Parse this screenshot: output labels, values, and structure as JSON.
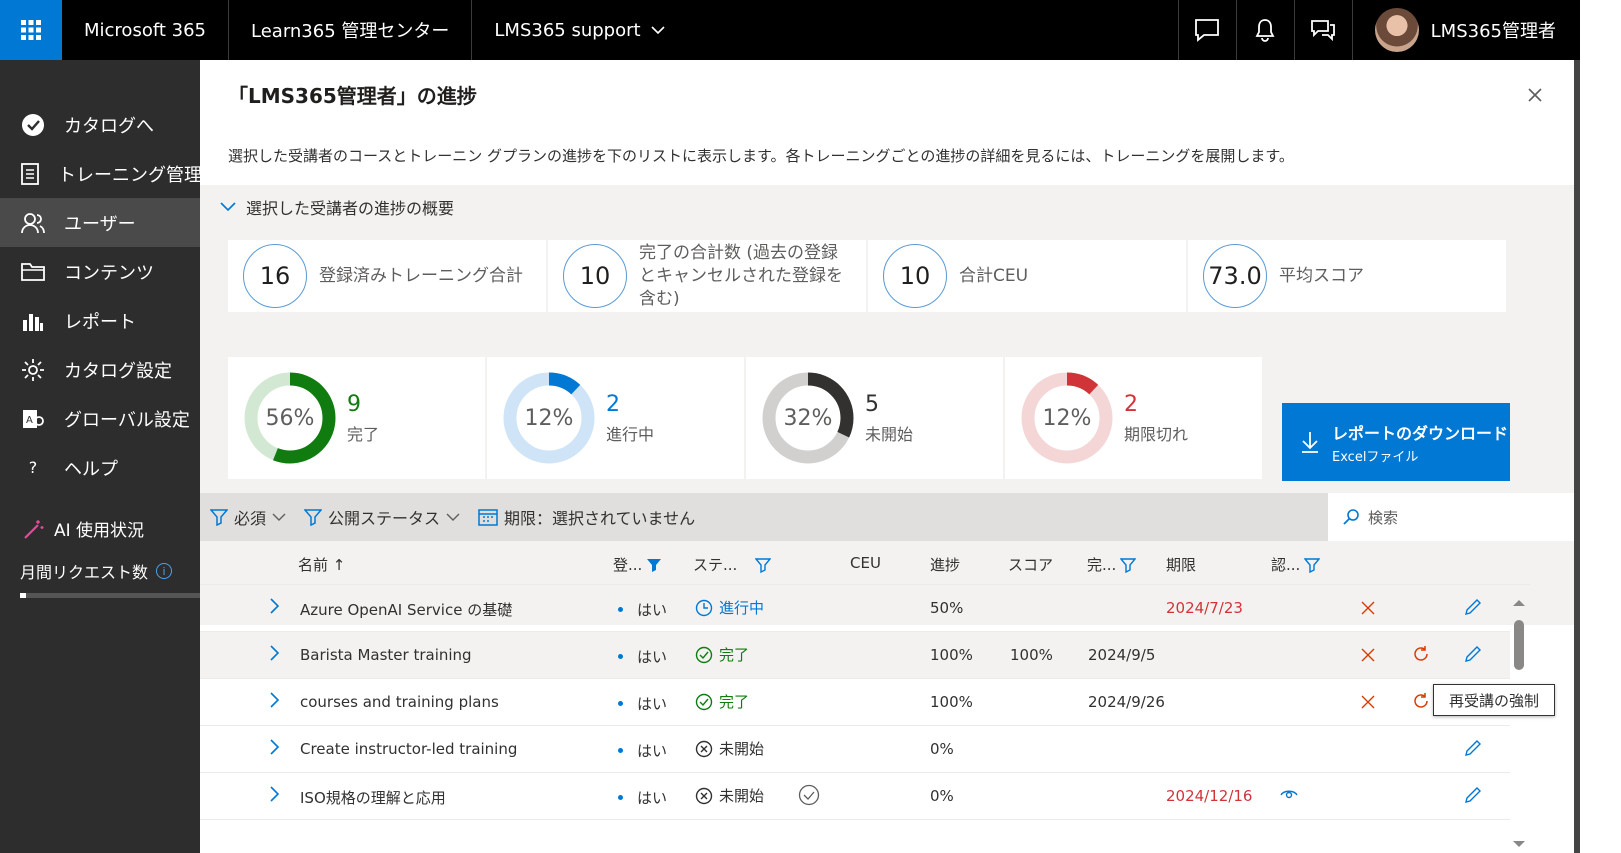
{
  "topbar": {
    "app": "Microsoft 365",
    "center": "Learn365 管理センター",
    "tenant": "LMS365 support",
    "user": "LMS365管理者"
  },
  "sidebar": {
    "items": [
      {
        "label": "カタログへ",
        "icon": "check-circle-icon"
      },
      {
        "label": "トレーニング管理",
        "icon": "document-icon"
      },
      {
        "label": "ユーザー",
        "icon": "users-icon",
        "active": true
      },
      {
        "label": "コンテンツ",
        "icon": "folder-icon"
      },
      {
        "label": "レポート",
        "icon": "chart-icon"
      },
      {
        "label": "カタログ設定",
        "icon": "gear-icon"
      },
      {
        "label": "グローバル設定",
        "icon": "global-settings-icon"
      },
      {
        "label": "ヘルプ",
        "icon": "question-icon"
      }
    ],
    "ai_usage": "AI 使用状況",
    "monthly_requests": "月間リクエスト数"
  },
  "panel": {
    "title": "「LMS365管理者」の進捗",
    "description": "選択した受講者のコースとトレーニン グプランの進捗を下のリストに表示します。各トレーニングごとの進捗の詳細を見るには、トレーニングを展開します。",
    "summary_heading": "選択した受講者の進捗の概要"
  },
  "kpis": [
    {
      "value": "16",
      "label": "登録済みトレーニング合計"
    },
    {
      "value": "10",
      "label": "完了の合計数 (過去の登録とキャンセルされた登録を含む)"
    },
    {
      "value": "10",
      "label": "合計CEU"
    },
    {
      "value": "73.0",
      "label": "平均スコア"
    }
  ],
  "donuts": [
    {
      "pct": "56%",
      "fraction": 0.56,
      "count": "9",
      "label": "完了",
      "color": "#107c10",
      "track": "#d3e8d3",
      "count_color": "#107c10"
    },
    {
      "pct": "12%",
      "fraction": 0.12,
      "count": "2",
      "label": "進行中",
      "color": "#0078d4",
      "track": "#cfe4f6",
      "count_color": "#0078d4"
    },
    {
      "pct": "32%",
      "fraction": 0.32,
      "count": "5",
      "label": "未開始",
      "color": "#323130",
      "track": "#d2d0ce",
      "count_color": "#323130"
    },
    {
      "pct": "12%",
      "fraction": 0.12,
      "count": "2",
      "label": "期限切れ",
      "color": "#d13438",
      "track": "#f4d6d7",
      "count_color": "#d13438"
    }
  ],
  "download": {
    "label": "レポートのダウンロード",
    "sub": "Excelファイル"
  },
  "filters": {
    "required": "必須",
    "publish": "公開ステータス",
    "deadline": "期限：選択されていません",
    "search_placeholder": "検索"
  },
  "columns": {
    "name": "名前 ↑",
    "reg": "登...",
    "status": "ステ...",
    "ceu": "CEU",
    "progress": "進捗",
    "score": "スコア",
    "completed": "完...",
    "deadline": "期限",
    "cert": "認..."
  },
  "rows": [
    {
      "name": "Azure OpenAI Service の基礎",
      "req": "はい",
      "status": "進行中",
      "status_type": "inprogress",
      "progress": "50%",
      "score": "",
      "completed": "",
      "deadline": "2024/7/23",
      "deadline_red": true,
      "cancel": true,
      "retake": false
    },
    {
      "name": "Barista Master training",
      "req": "はい",
      "status": "完了",
      "status_type": "done",
      "progress": "100%",
      "score": "100%",
      "completed": "2024/9/5",
      "deadline": "",
      "cancel": true,
      "retake": true
    },
    {
      "name": "courses and training plans",
      "req": "はい",
      "status": "完了",
      "status_type": "done",
      "progress": "100%",
      "score": "",
      "completed": "2024/9/26",
      "deadline": "",
      "cancel": true,
      "retake": true
    },
    {
      "name": "Create instructor-led training",
      "req": "はい",
      "status": "未開始",
      "status_type": "notstarted",
      "progress": "0%",
      "score": "",
      "completed": "",
      "deadline": "",
      "cancel": false,
      "retake": false
    },
    {
      "name": "ISO規格の理解と応用",
      "req": "はい",
      "status": "未開始",
      "status_type": "notstarted",
      "progress": "0%",
      "score": "",
      "completed": "",
      "deadline": "2024/12/16",
      "deadline_red": true,
      "cancel": false,
      "retake": false,
      "ceu_check": true,
      "cert_eye": true
    }
  ],
  "tooltip": "再受講の強制"
}
